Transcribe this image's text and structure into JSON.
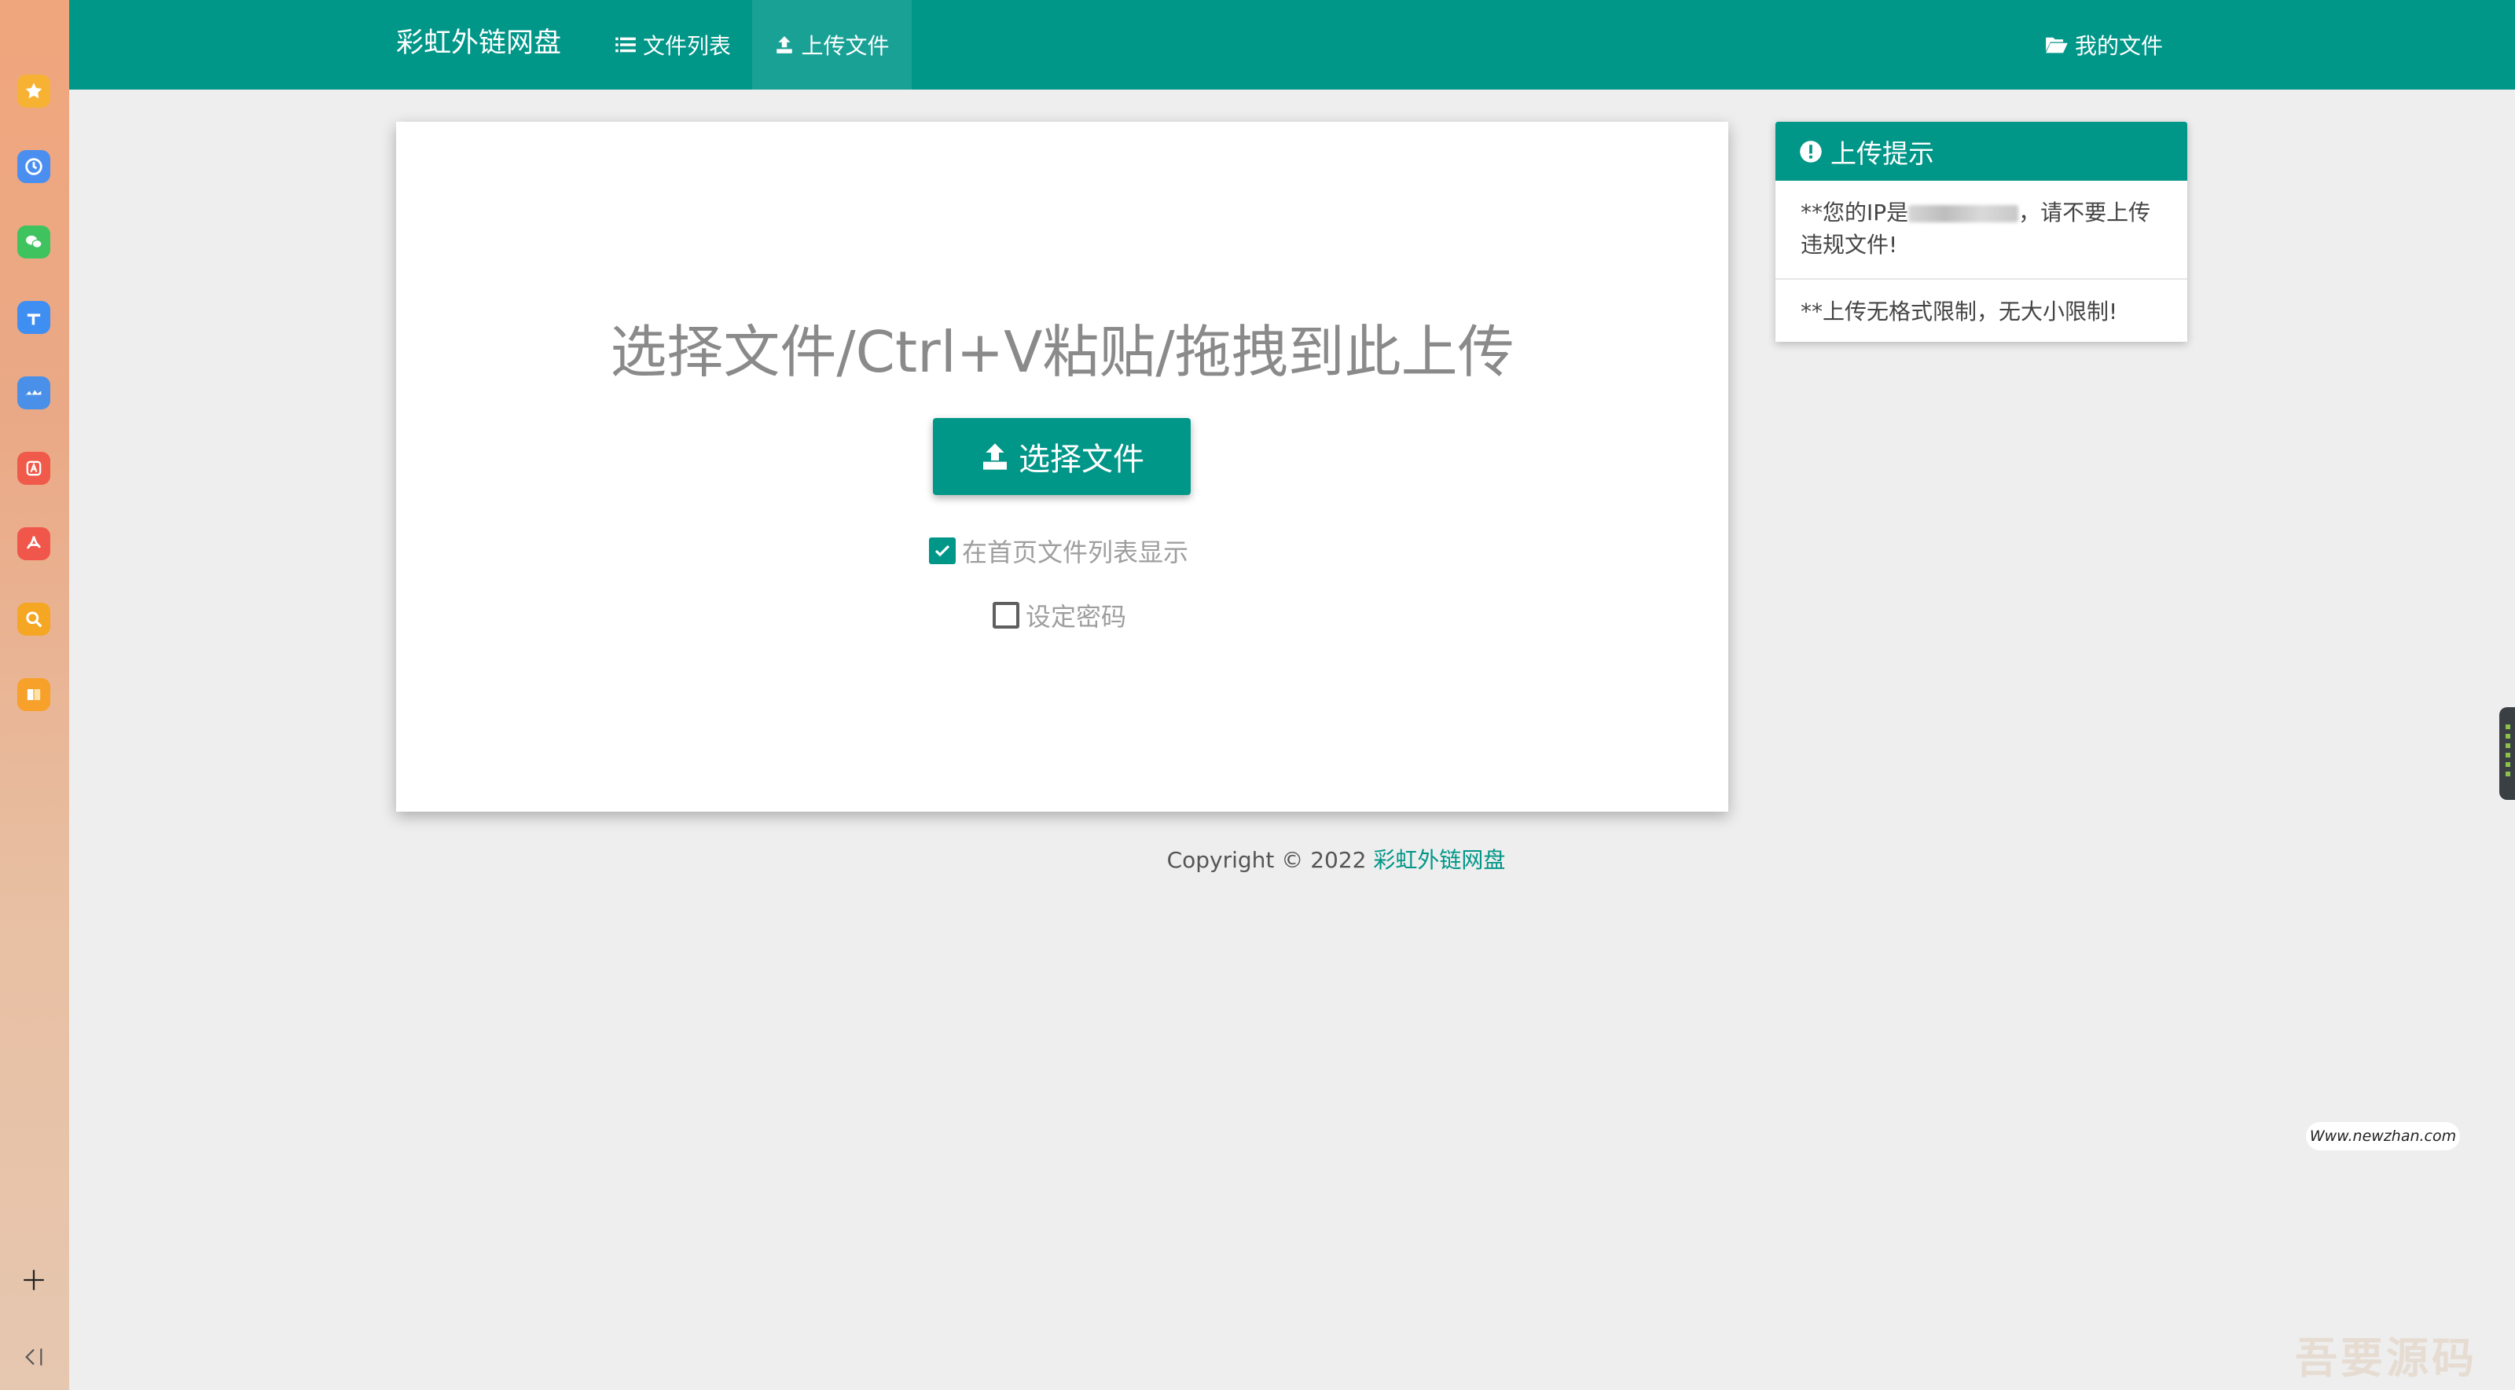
{
  "navbar": {
    "brand": "彩虹外链网盘",
    "items": [
      {
        "label": "文件列表",
        "active": false
      },
      {
        "label": "上传文件",
        "active": true
      }
    ],
    "my_files": "我的文件"
  },
  "upload": {
    "heading": "选择文件/Ctrl+V粘贴/拖拽到此上传",
    "choose_button": "选择文件",
    "show_on_home": {
      "label": "在首页文件列表显示",
      "checked": true
    },
    "set_password": {
      "label": "设定密码",
      "checked": false
    }
  },
  "footer": {
    "copyright_prefix": "Copyright © 2022",
    "site_name": "彩虹外链网盘"
  },
  "tips": {
    "title": "上传提示",
    "item1_before_ip": "**您的IP是",
    "item1_after_ip": "，请不要上传违规文件!",
    "item2": "**上传无格式限制，无大小限制!"
  },
  "watermarks": {
    "site": "Www.newzhan.com",
    "corner": "吾要源码"
  },
  "colors": {
    "primary": "#009688",
    "background": "#eeeeee"
  },
  "sidebar_icons": [
    "star-icon",
    "clock-icon",
    "wechat-icon",
    "plane-icon",
    "wave-icon",
    "translate-icon",
    "pdf-icon",
    "search-icon",
    "book-icon"
  ]
}
